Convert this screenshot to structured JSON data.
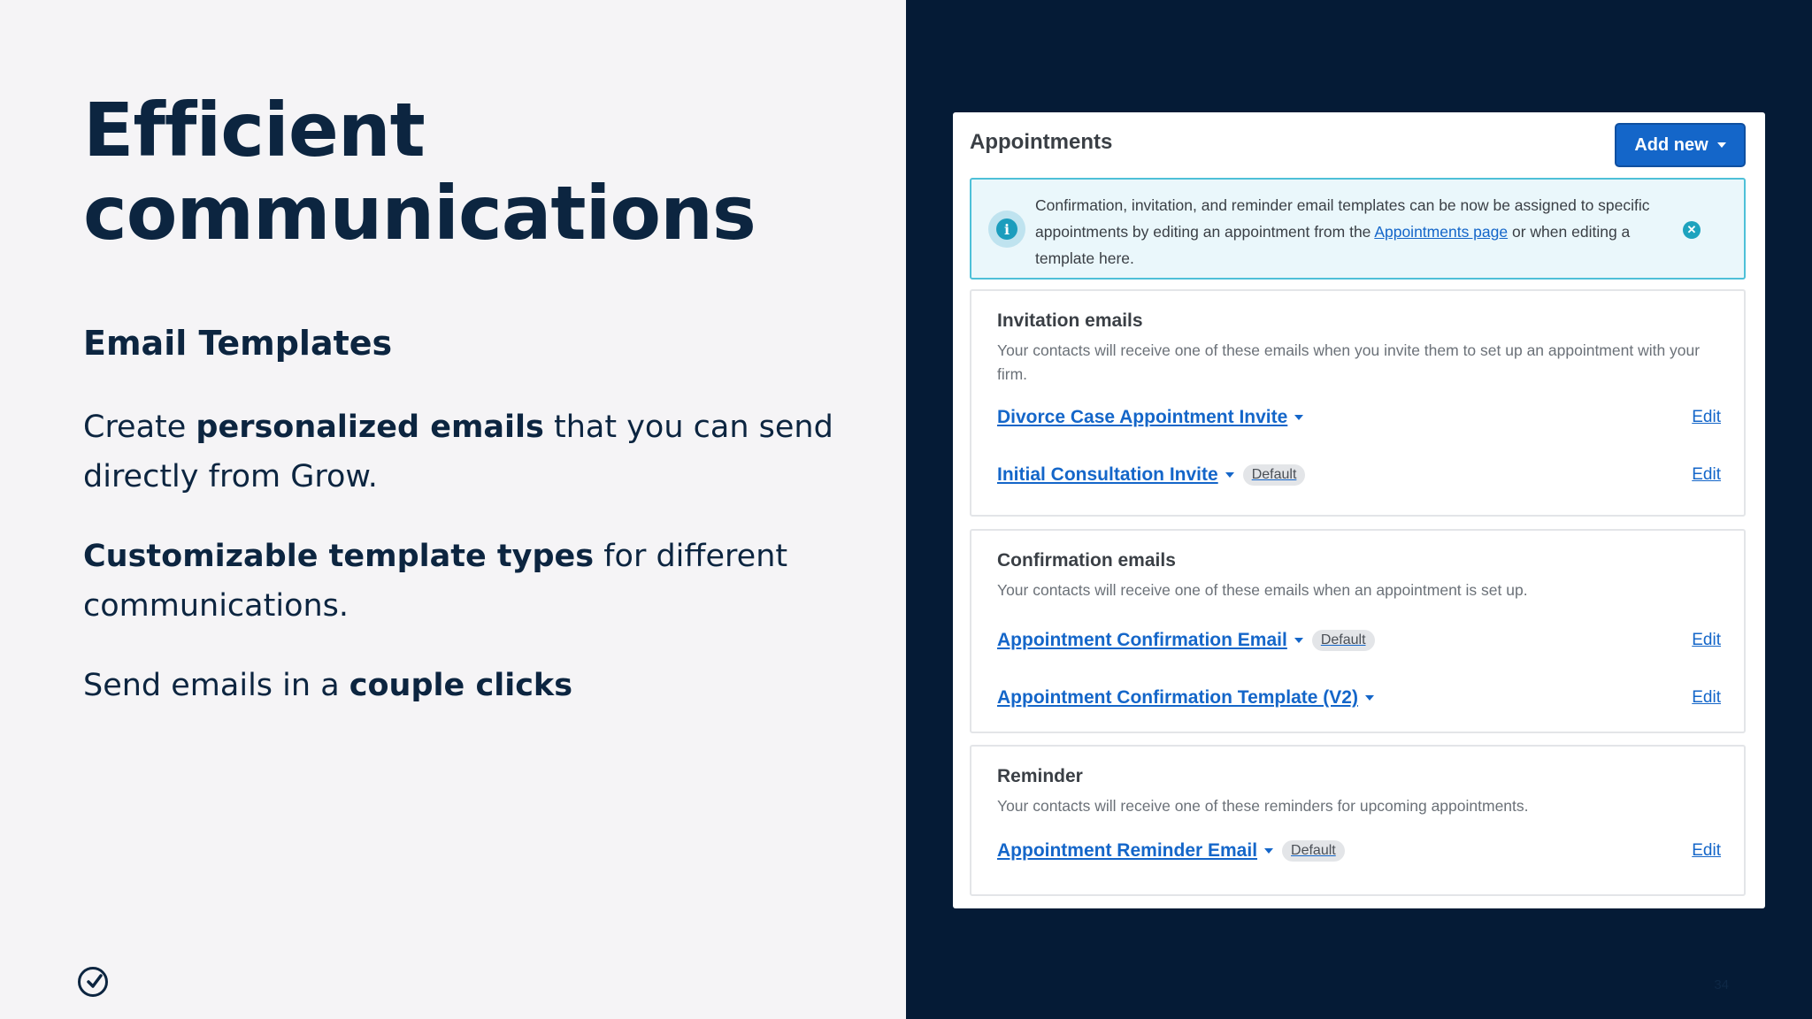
{
  "slide": {
    "title_line1": "Efficient",
    "title_line2": "communications",
    "subheading": "Email Templates",
    "p1": {
      "a": "Create ",
      "b": "personalized emails",
      "c": " that you can send directly from Grow."
    },
    "p2": {
      "b": "Customizable template types",
      "c": " for different communications."
    },
    "p3": {
      "a": "Send emails in a ",
      "b": "couple clicks"
    },
    "logo_icon": "checkmark-circle-icon",
    "page_number": "34"
  },
  "app": {
    "title": "Appointments",
    "add_button": "Add new",
    "alert": {
      "text_before": "Confirmation, invitation, and reminder email templates can be now be assigned to specific appointments by editing an appointment from the ",
      "link": "Appointments page",
      "text_after": " or when editing a template here.",
      "close_glyph": "✕"
    },
    "sections": [
      {
        "title": "Invitation emails",
        "description": "Your contacts will receive one of these emails when you invite them to set up an appointment with your firm.",
        "rows": [
          {
            "name": "Divorce Case Appointment Invite",
            "badge": "",
            "edit": "Edit"
          },
          {
            "name": "Initial Consultation Invite",
            "badge": "Default",
            "edit": "Edit"
          }
        ]
      },
      {
        "title": "Confirmation emails",
        "description": "Your contacts will receive one of these emails when an appointment is set up.",
        "rows": [
          {
            "name": "Appointment Confirmation Email",
            "badge": "Default",
            "edit": "Edit"
          },
          {
            "name": "Appointment Confirmation Template (V2)",
            "badge": "",
            "edit": "Edit"
          }
        ]
      },
      {
        "title": "Reminder",
        "description": "Your contacts will receive one of these reminders for upcoming appointments.",
        "rows": [
          {
            "name": "Appointment Reminder Email",
            "badge": "Default",
            "edit": "Edit"
          }
        ]
      }
    ]
  },
  "colors": {
    "navy": "#0c2540",
    "dark_panel": "#051b36",
    "link_blue": "#1466c9",
    "alert_border": "#4ec0d8"
  }
}
